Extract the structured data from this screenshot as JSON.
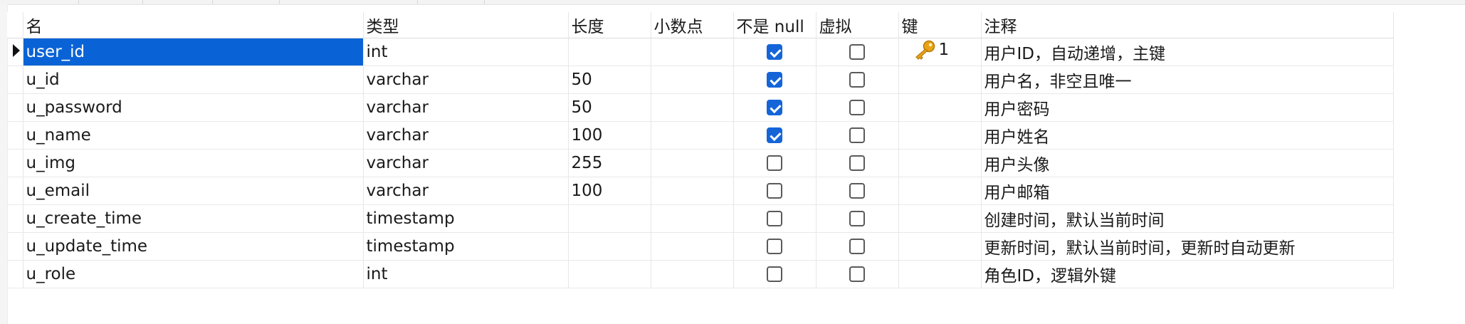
{
  "columns": [
    {
      "label": "名"
    },
    {
      "label": "类型"
    },
    {
      "label": "长度"
    },
    {
      "label": "小数点"
    },
    {
      "label": "不是 null"
    },
    {
      "label": "虚拟"
    },
    {
      "label": "键"
    },
    {
      "label": "注释"
    }
  ],
  "rows": [
    {
      "name": "user_id",
      "type": "int",
      "length": "",
      "decimals": "",
      "not_null": true,
      "virtual": false,
      "key": "1",
      "comment": "用户ID，自动递增，主键"
    },
    {
      "name": "u_id",
      "type": "varchar",
      "length": "50",
      "decimals": "",
      "not_null": true,
      "virtual": false,
      "key": "",
      "comment": "用户名，非空且唯一"
    },
    {
      "name": "u_password",
      "type": "varchar",
      "length": "50",
      "decimals": "",
      "not_null": true,
      "virtual": false,
      "key": "",
      "comment": "用户密码"
    },
    {
      "name": "u_name",
      "type": "varchar",
      "length": "100",
      "decimals": "",
      "not_null": true,
      "virtual": false,
      "key": "",
      "comment": "用户姓名"
    },
    {
      "name": "u_img",
      "type": "varchar",
      "length": "255",
      "decimals": "",
      "not_null": false,
      "virtual": false,
      "key": "",
      "comment": "用户头像"
    },
    {
      "name": "u_email",
      "type": "varchar",
      "length": "100",
      "decimals": "",
      "not_null": false,
      "virtual": false,
      "key": "",
      "comment": "用户邮箱"
    },
    {
      "name": "u_create_time",
      "type": "timestamp",
      "length": "",
      "decimals": "",
      "not_null": false,
      "virtual": false,
      "key": "",
      "comment": "创建时间，默认当前时间"
    },
    {
      "name": "u_update_time",
      "type": "timestamp",
      "length": "",
      "decimals": "",
      "not_null": false,
      "virtual": false,
      "key": "",
      "comment": "更新时间，默认当前时间，更新时自动更新"
    },
    {
      "name": "u_role",
      "type": "int",
      "length": "",
      "decimals": "",
      "not_null": false,
      "virtual": false,
      "key": "",
      "comment": "角色ID，逻辑外键"
    }
  ],
  "selected_row": 0,
  "icons": {
    "row_indicator": "current-row-arrow-icon",
    "primary_key": "key-icon"
  },
  "colors": {
    "selection": "#0a63d6",
    "checkbox_checked": "#1565d8",
    "key_gold": "#e8a317"
  }
}
